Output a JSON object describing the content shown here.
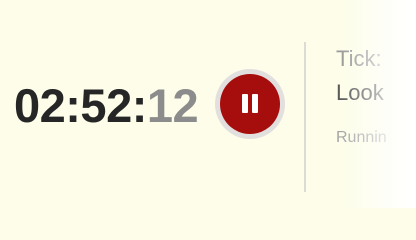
{
  "timer": {
    "hours_minutes": "02:52:",
    "seconds": "12"
  },
  "pause_button": {
    "icon": "pause-icon"
  },
  "info": {
    "line1": "Tick:",
    "line2": "Look",
    "line3": "Runnin"
  },
  "colors": {
    "background": "#fdfde9",
    "button": "#a60e0e",
    "button_ring": "#e2dfdf",
    "timer_text": "#262626",
    "seconds_text": "#8c8c8c"
  }
}
